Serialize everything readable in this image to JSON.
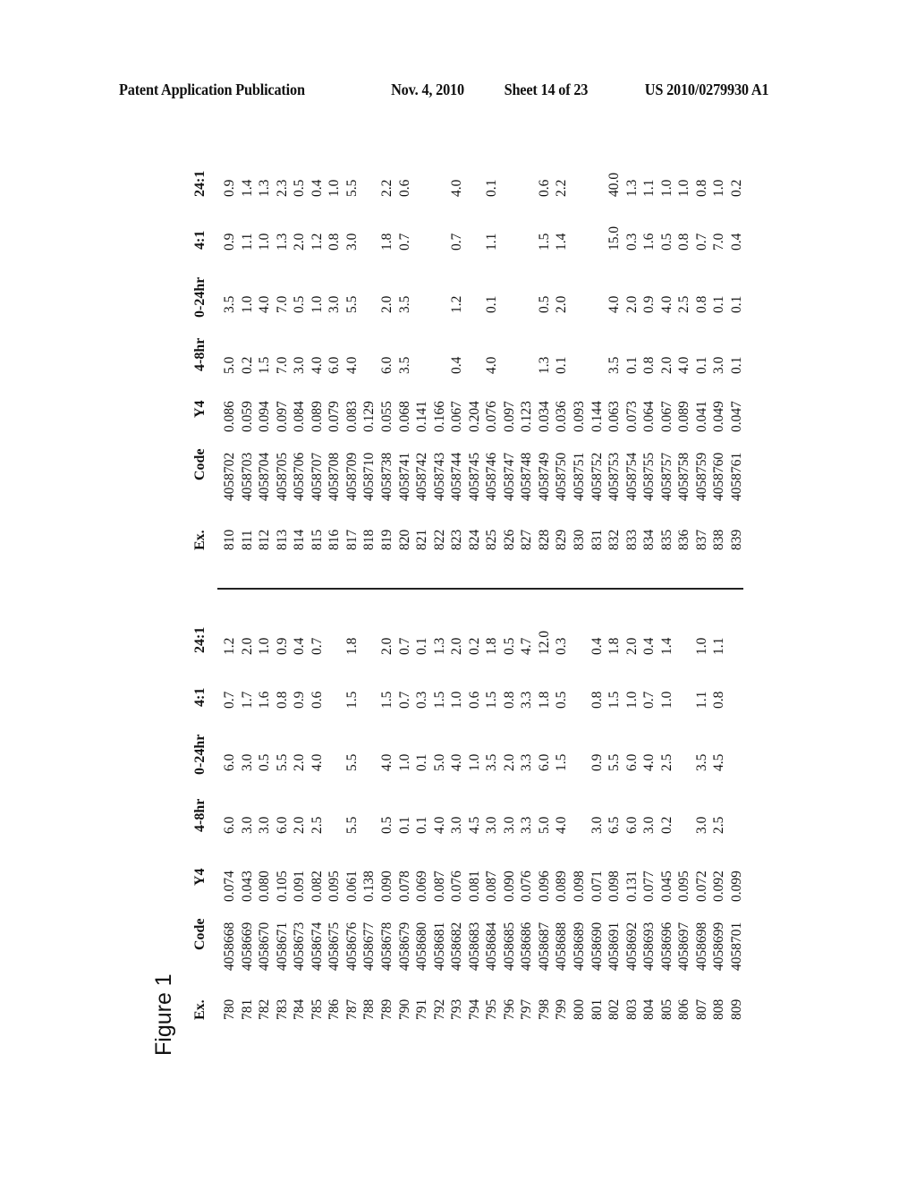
{
  "header": {
    "publication": "Patent Application Publication",
    "date": "Nov. 4, 2010",
    "sheet": "Sheet 14 of 23",
    "number": "US 2010/0279930 A1"
  },
  "figure_label": "Figure 1",
  "columns": [
    "Ex.",
    "Code",
    "Y4",
    "4-8hr",
    "0-24hr",
    "4:1",
    "24:1"
  ],
  "tables": [
    {
      "rows": [
        [
          "780",
          "4058668",
          "0.074",
          "6.0",
          "6.0",
          "0.7",
          "1.2"
        ],
        [
          "781",
          "4058669",
          "0.043",
          "3.0",
          "3.0",
          "1.7",
          "2.0"
        ],
        [
          "782",
          "4058670",
          "0.080",
          "3.0",
          "0.5",
          "1.6",
          "1.0"
        ],
        [
          "783",
          "4058671",
          "0.105",
          "6.0",
          "5.5",
          "0.8",
          "0.9"
        ],
        [
          "784",
          "4058673",
          "0.091",
          "2.0",
          "2.0",
          "0.9",
          "0.4"
        ],
        [
          "785",
          "4058674",
          "0.082",
          "2.5",
          "4.0",
          "0.6",
          "0.7"
        ],
        [
          "786",
          "4058675",
          "0.095",
          "",
          "",
          "",
          ""
        ],
        [
          "787",
          "4058676",
          "0.061",
          "5.5",
          "5.5",
          "1.5",
          "1.8"
        ],
        [
          "788",
          "4058677",
          "0.138",
          "",
          "",
          "",
          ""
        ],
        [
          "789",
          "4058678",
          "0.090",
          "0.5",
          "4.0",
          "1.5",
          "2.0"
        ],
        [
          "790",
          "4058679",
          "0.078",
          "0.1",
          "1.0",
          "0.7",
          "0.7"
        ],
        [
          "791",
          "4058680",
          "0.069",
          "0.1",
          "0.1",
          "0.3",
          "0.1"
        ],
        [
          "792",
          "4058681",
          "0.087",
          "4.0",
          "5.0",
          "1.5",
          "1.3"
        ],
        [
          "793",
          "4058682",
          "0.076",
          "3.0",
          "4.0",
          "1.0",
          "2.0"
        ],
        [
          "794",
          "4058683",
          "0.081",
          "4.5",
          "1.0",
          "0.6",
          "0.2"
        ],
        [
          "795",
          "4058684",
          "0.087",
          "3.0",
          "3.5",
          "1.5",
          "1.8"
        ],
        [
          "796",
          "4058685",
          "0.090",
          "3.0",
          "2.0",
          "0.8",
          "0.5"
        ],
        [
          "797",
          "4058686",
          "0.076",
          "3.3",
          "3.3",
          "3.3",
          "4.7"
        ],
        [
          "798",
          "4058687",
          "0.096",
          "5.0",
          "6.0",
          "1.8",
          "12.0"
        ],
        [
          "799",
          "4058688",
          "0.089",
          "4.0",
          "1.5",
          "0.5",
          "0.3"
        ],
        [
          "800",
          "4058689",
          "0.098",
          "",
          "",
          "",
          ""
        ],
        [
          "801",
          "4058690",
          "0.071",
          "3.0",
          "0.9",
          "0.8",
          "0.4"
        ],
        [
          "802",
          "4058691",
          "0.098",
          "6.5",
          "5.5",
          "1.5",
          "1.8"
        ],
        [
          "803",
          "4058692",
          "0.131",
          "6.0",
          "6.0",
          "1.0",
          "2.0"
        ],
        [
          "804",
          "4058693",
          "0.077",
          "3.0",
          "4.0",
          "0.7",
          "0.4"
        ],
        [
          "805",
          "4058696",
          "0.045",
          "0.2",
          "2.5",
          "1.0",
          "1.4"
        ],
        [
          "806",
          "4058697",
          "0.095",
          "",
          "",
          "",
          ""
        ],
        [
          "807",
          "4058698",
          "0.072",
          "3.0",
          "3.5",
          "1.1",
          "1.0"
        ],
        [
          "808",
          "4058699",
          "0.092",
          "2.5",
          "4.5",
          "0.8",
          "1.1"
        ],
        [
          "809",
          "4058701",
          "0.099",
          "",
          "",
          "",
          ""
        ]
      ]
    },
    {
      "rows": [
        [
          "810",
          "4058702",
          "0.086",
          "5.0",
          "3.5",
          "0.9",
          "0.9"
        ],
        [
          "811",
          "4058703",
          "0.059",
          "0.2",
          "1.0",
          "1.1",
          "1.4"
        ],
        [
          "812",
          "4058704",
          "0.094",
          "1.5",
          "4.0",
          "1.0",
          "1.3"
        ],
        [
          "813",
          "4058705",
          "0.097",
          "7.0",
          "7.0",
          "1.3",
          "2.3"
        ],
        [
          "814",
          "4058706",
          "0.084",
          "3.0",
          "0.5",
          "2.0",
          "0.5"
        ],
        [
          "815",
          "4058707",
          "0.089",
          "4.0",
          "1.0",
          "1.2",
          "0.4"
        ],
        [
          "816",
          "4058708",
          "0.079",
          "6.0",
          "3.0",
          "0.8",
          "1.0"
        ],
        [
          "817",
          "4058709",
          "0.083",
          "4.0",
          "5.5",
          "3.0",
          "5.5"
        ],
        [
          "818",
          "4058710",
          "0.129",
          "",
          "",
          "",
          ""
        ],
        [
          "819",
          "4058738",
          "0.055",
          "6.0",
          "2.0",
          "1.8",
          "2.2"
        ],
        [
          "820",
          "4058741",
          "0.068",
          "3.5",
          "3.5",
          "0.7",
          "0.6"
        ],
        [
          "821",
          "4058742",
          "0.141",
          "",
          "",
          "",
          ""
        ],
        [
          "822",
          "4058743",
          "0.166",
          "",
          "",
          "",
          ""
        ],
        [
          "823",
          "4058744",
          "0.067",
          "0.4",
          "1.2",
          "0.7",
          "4.0"
        ],
        [
          "824",
          "4058745",
          "0.204",
          "",
          "",
          "",
          ""
        ],
        [
          "825",
          "4058746",
          "0.076",
          "4.0",
          "0.1",
          "1.1",
          "0.1"
        ],
        [
          "826",
          "4058747",
          "0.097",
          "",
          "",
          "",
          ""
        ],
        [
          "827",
          "4058748",
          "0.123",
          "",
          "",
          "",
          ""
        ],
        [
          "828",
          "4058749",
          "0.034",
          "1.3",
          "0.5",
          "1.5",
          "0.6"
        ],
        [
          "829",
          "4058750",
          "0.036",
          "0.1",
          "2.0",
          "1.4",
          "2.2"
        ],
        [
          "830",
          "4058751",
          "0.093",
          "",
          "",
          "",
          ""
        ],
        [
          "831",
          "4058752",
          "0.144",
          "",
          "",
          "",
          ""
        ],
        [
          "832",
          "4058753",
          "0.063",
          "3.5",
          "4.0",
          "15.0",
          "40.0"
        ],
        [
          "833",
          "4058754",
          "0.073",
          "0.1",
          "2.0",
          "0.3",
          "1.3"
        ],
        [
          "834",
          "4058755",
          "0.064",
          "0.8",
          "0.9",
          "1.6",
          "1.1"
        ],
        [
          "835",
          "4058757",
          "0.067",
          "2.0",
          "4.0",
          "0.5",
          "1.0"
        ],
        [
          "836",
          "4058758",
          "0.089",
          "4.0",
          "2.5",
          "0.8",
          "1.0"
        ],
        [
          "837",
          "4058759",
          "0.041",
          "0.1",
          "0.8",
          "0.7",
          "0.8"
        ],
        [
          "838",
          "4058760",
          "0.049",
          "3.0",
          "0.1",
          "7.0",
          "1.0"
        ],
        [
          "839",
          "4058761",
          "0.047",
          "0.1",
          "0.1",
          "0.4",
          "0.2"
        ]
      ]
    }
  ]
}
